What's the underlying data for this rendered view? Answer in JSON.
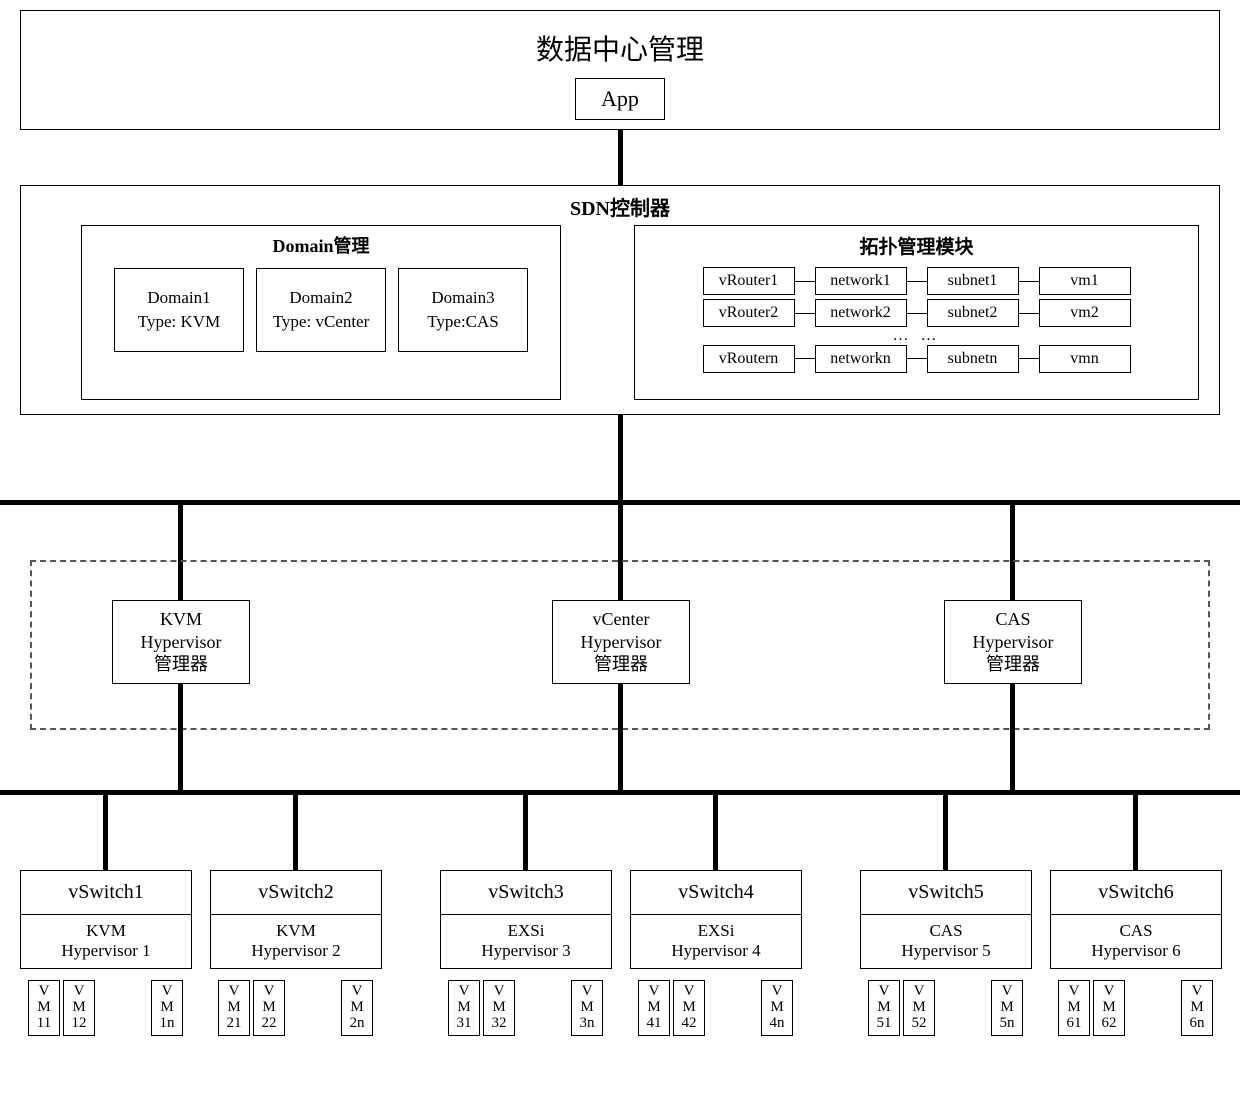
{
  "top": {
    "title": "数据中心管理",
    "app": "App"
  },
  "sdn": {
    "title": "SDN控制器",
    "domain_title": "Domain管理",
    "domains": [
      {
        "name": "Domain1",
        "type": "Type: KVM"
      },
      {
        "name": "Domain2",
        "type": "Type: vCenter"
      },
      {
        "name": "Domain3",
        "type": "Type:CAS"
      }
    ],
    "topo_title": "拓扑管理模块",
    "topo_rows": [
      [
        "vRouter1",
        "network1",
        "subnet1",
        "vm1"
      ],
      [
        "vRouter2",
        "network2",
        "subnet2",
        "vm2"
      ],
      [
        "vRoutern",
        "networkn",
        "subnetn",
        "vmn"
      ]
    ],
    "dots": "… …"
  },
  "hypervisors": [
    {
      "l1": "KVM",
      "l2": "Hypervisor",
      "l3": "管理器"
    },
    {
      "l1": "vCenter",
      "l2": "Hypervisor",
      "l3": "管理器"
    },
    {
      "l1": "CAS",
      "l2": "Hypervisor",
      "l3": "管理器"
    }
  ],
  "vswitches": [
    {
      "name": "vSwitch1",
      "hv1": "KVM",
      "hv2": "Hypervisor 1",
      "vms": [
        "VM11",
        "VM12",
        "VM1n"
      ]
    },
    {
      "name": "vSwitch2",
      "hv1": "KVM",
      "hv2": "Hypervisor 2",
      "vms": [
        "VM21",
        "VM22",
        "VM2n"
      ]
    },
    {
      "name": "vSwitch3",
      "hv1": "EXSi",
      "hv2": "Hypervisor 3",
      "vms": [
        "VM31",
        "VM32",
        "VM3n"
      ]
    },
    {
      "name": "vSwitch4",
      "hv1": "EXSi",
      "hv2": "Hypervisor 4",
      "vms": [
        "VM41",
        "VM42",
        "VM4n"
      ]
    },
    {
      "name": "vSwitch5",
      "hv1": "CAS",
      "hv2": "Hypervisor 5",
      "vms": [
        "VM51",
        "VM52",
        "VM5n"
      ]
    },
    {
      "name": "vSwitch6",
      "hv1": "CAS",
      "hv2": "Hypervisor 6",
      "vms": [
        "VM61",
        "VM62",
        "VM6n"
      ]
    }
  ]
}
